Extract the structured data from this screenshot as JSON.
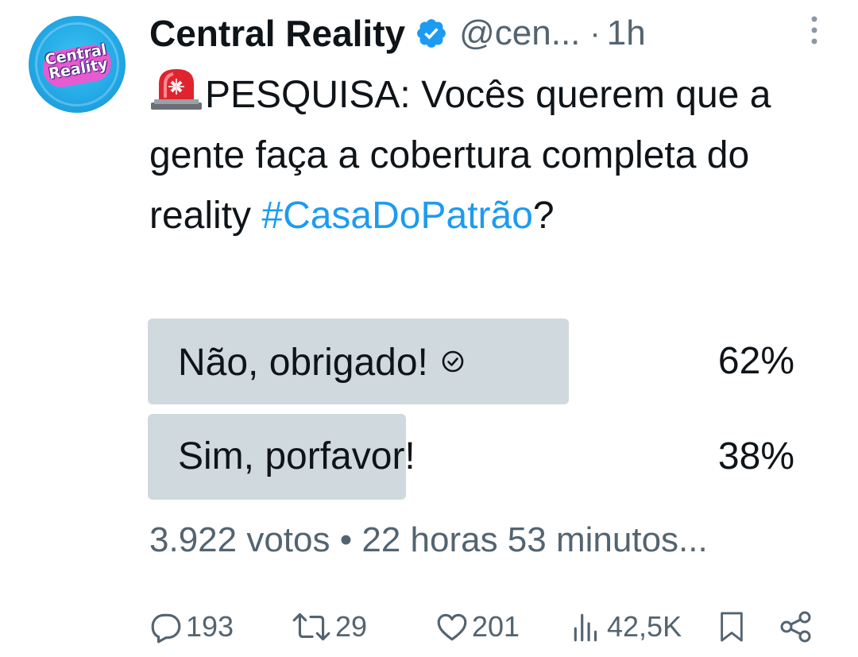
{
  "tweet": {
    "author_name": "Central Reality",
    "handle": "@cen...",
    "separator": "·",
    "time": "1h",
    "avatar_text_line1": "Central",
    "avatar_text_line2": "Reality",
    "text_main": "PESQUISA: Vocês querem que a gente faça a cobertura completa do reality ",
    "hashtag": "#CasaDoPatrão",
    "text_end": "?"
  },
  "poll": {
    "options": [
      {
        "label": "Não, obrigado!",
        "percent_text": "62%",
        "percent": 62,
        "chosen": true
      },
      {
        "label": "Sim, porfavor!",
        "percent_text": "38%",
        "percent": 38,
        "chosen": false
      }
    ],
    "meta": "3.922 votos • 22 horas 53 minutos..."
  },
  "actions": {
    "replies": "193",
    "reposts": "29",
    "likes": "201",
    "views": "42,5K"
  },
  "icons": {
    "verified": "verified-badge-icon",
    "more": "more-vertical-icon",
    "siren": "siren-emoji-icon",
    "check": "check-circle-icon",
    "reply": "reply-icon",
    "repost": "repost-icon",
    "like": "heart-icon",
    "views": "views-icon",
    "bookmark": "bookmark-icon",
    "share": "share-icon"
  },
  "colors": {
    "text": "#0f1419",
    "secondary": "#536471",
    "link": "#1d9bf0",
    "verified": "#1d9bf0",
    "poll_fill": "#cfd9de"
  }
}
